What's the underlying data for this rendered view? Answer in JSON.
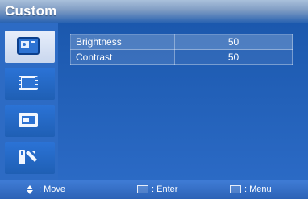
{
  "menu": {
    "title": "Custom",
    "items": [
      {
        "label": "Brightness",
        "value": "50"
      },
      {
        "label": "Contrast",
        "value": "50"
      }
    ]
  },
  "sidebar": {
    "icons": [
      "picture-icon",
      "film-strip-icon",
      "screen-mode-icon",
      "setup-tools-icon"
    ]
  },
  "status": {
    "move": ": Move",
    "enter": ": Enter",
    "menu": ": Menu"
  },
  "colors": {
    "background": "#1f5fb4",
    "title_text": "#ffffff",
    "row_text": "#ffffff",
    "selected_sidebar": "#e7eefb"
  }
}
